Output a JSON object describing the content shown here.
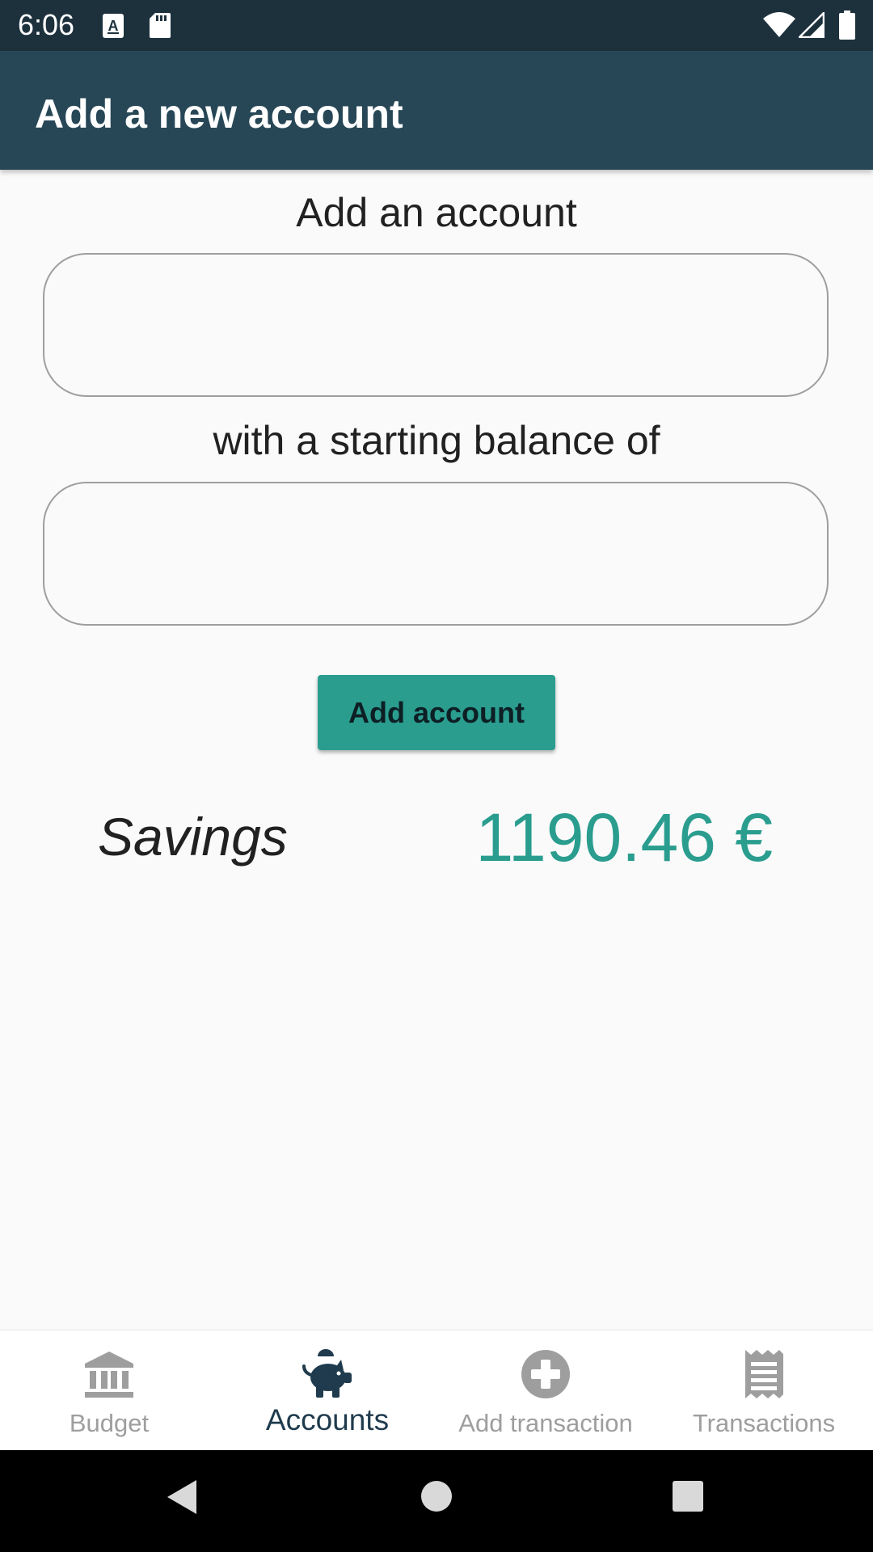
{
  "status_bar": {
    "time": "6:06",
    "icons": [
      "a-notification-icon",
      "sd-card-icon",
      "wifi-icon",
      "cellular-signal-icon",
      "battery-icon"
    ]
  },
  "app_bar": {
    "title": "Add a new account"
  },
  "form": {
    "account_label": "Add an account",
    "account_input_value": "",
    "balance_label": "with a starting balance of",
    "balance_input_value": "",
    "submit_label": "Add account"
  },
  "accounts": [
    {
      "name": "Savings",
      "balance": "1190.46 €"
    }
  ],
  "bottom_nav": {
    "items": [
      {
        "label": "Budget",
        "icon": "bank-icon",
        "active": false
      },
      {
        "label": "Accounts",
        "icon": "piggy-bank-icon",
        "active": true
      },
      {
        "label": "Add transaction",
        "icon": "add-circle-icon",
        "active": false
      },
      {
        "label": "Transactions",
        "icon": "receipt-icon",
        "active": false
      }
    ]
  },
  "system_nav": {
    "buttons": [
      "back-icon",
      "home-icon",
      "recents-icon"
    ]
  },
  "colors": {
    "status_bar": "#1d313d",
    "app_bar": "#274756",
    "accent": "#2a9d8f",
    "nav_active": "#1f3b4d",
    "nav_inactive": "#9e9e9e",
    "background": "#fafafa"
  }
}
